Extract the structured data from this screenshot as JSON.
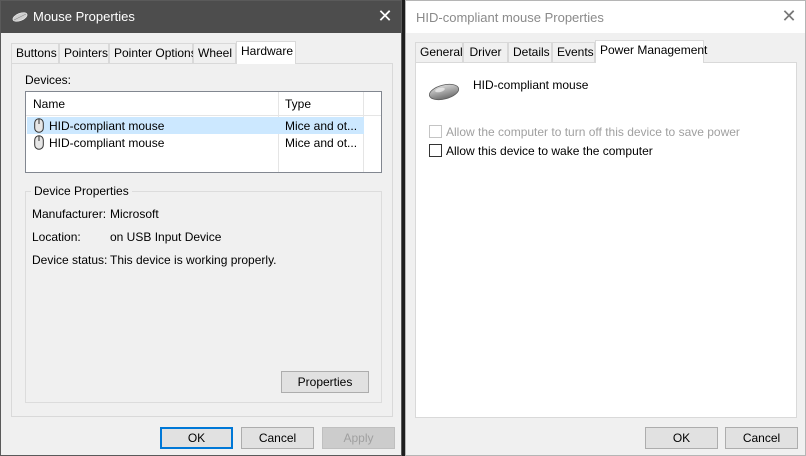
{
  "left_window": {
    "title": "Mouse Properties",
    "tabs": [
      "Buttons",
      "Pointers",
      "Pointer Options",
      "Wheel",
      "Hardware"
    ],
    "active_tab": "Hardware",
    "devices_label": "Devices:",
    "columns": {
      "name": "Name",
      "type": "Type"
    },
    "devices": [
      {
        "name": "HID-compliant mouse",
        "type": "Mice and ot..."
      },
      {
        "name": "HID-compliant mouse",
        "type": "Mice and ot..."
      }
    ],
    "device_properties": {
      "title": "Device Properties",
      "manufacturer_label": "Manufacturer:",
      "manufacturer": "Microsoft",
      "location_label": "Location:",
      "location": "on USB Input Device",
      "status_label": "Device status:",
      "status": "This device is working properly."
    },
    "properties_button": "Properties",
    "ok_button": "OK",
    "cancel_button": "Cancel",
    "apply_button": "Apply"
  },
  "right_window": {
    "title": "HID-compliant mouse Properties",
    "tabs": [
      "General",
      "Driver",
      "Details",
      "Events",
      "Power Management"
    ],
    "active_tab": "Power Management",
    "device_name": "HID-compliant mouse",
    "allow_turn_off": "Allow the computer to turn off this device to save power",
    "allow_wake": "Allow this device to wake the computer",
    "ok_button": "OK",
    "cancel_button": "Cancel"
  },
  "colors": {
    "left_titlebar": "#4d4d4d",
    "selection": "#cce8ff",
    "default_button_border": "#0078d7"
  }
}
